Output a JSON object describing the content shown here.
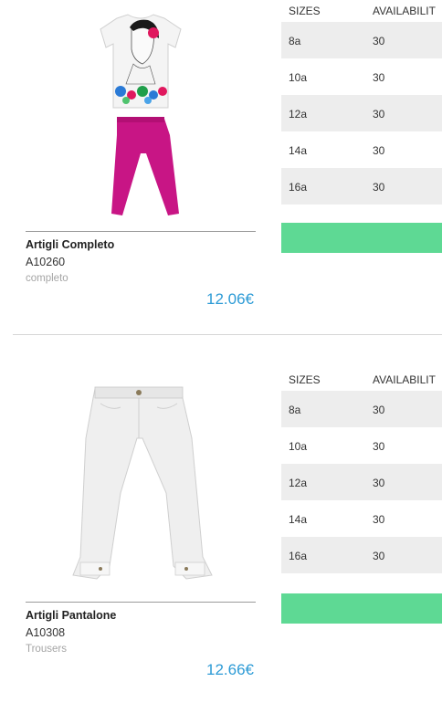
{
  "products": [
    {
      "name": "Artigli Completo",
      "code": "A10260",
      "category": "completo",
      "price": "12.06€",
      "table": {
        "header_size": "SIZES",
        "header_availability": "AVAILABILIT",
        "rows": [
          {
            "size": "8a",
            "availability": "30"
          },
          {
            "size": "10a",
            "availability": "30"
          },
          {
            "size": "12a",
            "availability": "30"
          },
          {
            "size": "14a",
            "availability": "30"
          },
          {
            "size": "16a",
            "availability": "30"
          }
        ]
      },
      "colors": {
        "shirt": "#f2f2f2",
        "pants": "#c81585"
      }
    },
    {
      "name": "Artigli Pantalone",
      "code": "A10308",
      "category": "Trousers",
      "price": "12.66€",
      "table": {
        "header_size": "SIZES",
        "header_availability": "AVAILABILIT",
        "rows": [
          {
            "size": "8a",
            "availability": "30"
          },
          {
            "size": "10a",
            "availability": "30"
          },
          {
            "size": "12a",
            "availability": "30"
          },
          {
            "size": "14a",
            "availability": "30"
          },
          {
            "size": "16a",
            "availability": "30"
          }
        ]
      },
      "colors": {
        "trousers": "#eeeeee"
      }
    }
  ],
  "accent_colors": {
    "price": "#2d9bd6",
    "button": "#5ed994",
    "row_stripe": "#ededed"
  }
}
